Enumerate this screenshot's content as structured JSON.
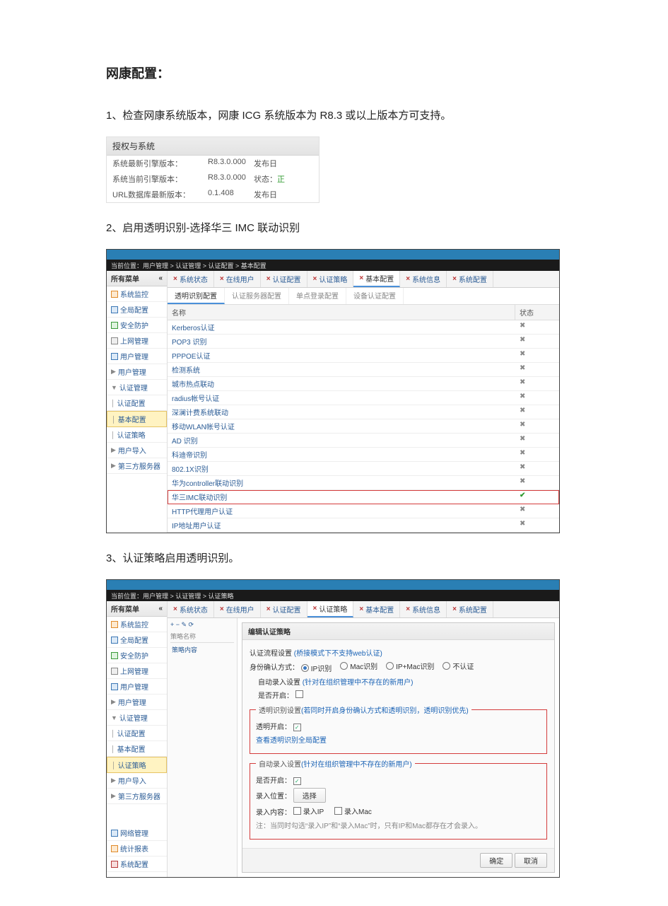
{
  "doc": {
    "title": "网康配置：",
    "step1": "1、检查网康系统版本，网康 ICG 系统版本为 R8.3 或以上版本方可支持。",
    "step2": "2、启用透明识别-选择华三 IMC 联动识别",
    "step3": "3、认证策略启用透明识别。"
  },
  "shot1": {
    "panel_title": "授权与系统",
    "rows": [
      {
        "k": "系统最新引擎版本：",
        "v": "R8.3.0.000",
        "r": "发布日"
      },
      {
        "k": "系统当前引擎版本：",
        "v": "R8.3.0.000",
        "r": "状态：",
        "r_style": "green",
        "r_val": "正"
      },
      {
        "k": "URL数据库最新版本：",
        "v": "0.1.408",
        "r": "发布日"
      }
    ]
  },
  "sidebar_title": "所有菜单",
  "sidebar": [
    {
      "label": "系统监控",
      "color": "orange"
    },
    {
      "label": "全局配置",
      "color": "blue"
    },
    {
      "label": "安全防护",
      "color": "green"
    },
    {
      "label": "上网管理",
      "color": "grey"
    },
    {
      "label": "用户管理",
      "color": "blue"
    },
    {
      "label": "用户管理",
      "color": "",
      "tree": "▶"
    },
    {
      "label": "认证管理",
      "color": "",
      "tree": "▼"
    },
    {
      "label": "认证配置",
      "color": "",
      "tree": "│ "
    },
    {
      "label": "基本配置",
      "color": "",
      "tree": "│ ",
      "sel2": true
    },
    {
      "label": "认证策略",
      "color": "",
      "tree": "│ ",
      "sel3": true
    },
    {
      "label": "用户导入",
      "color": "",
      "tree": "▶"
    },
    {
      "label": "第三方服务器",
      "color": "",
      "tree": "▶"
    }
  ],
  "sidebar_bottom": [
    {
      "label": "网络管理",
      "color": "blue"
    },
    {
      "label": "统计报表",
      "color": "orange"
    },
    {
      "label": "系统配置",
      "color": "red"
    }
  ],
  "tabs_top": [
    {
      "label": "系统状态"
    },
    {
      "label": "在线用户"
    },
    {
      "label": "认证配置"
    },
    {
      "label": "认证策略"
    },
    {
      "label": "基本配置",
      "sel": true
    },
    {
      "label": "系统信息"
    },
    {
      "label": "系统配置"
    }
  ],
  "shot2": {
    "subtabs": [
      {
        "label": "透明识别配置",
        "on": true
      },
      {
        "label": "认证服务器配置"
      },
      {
        "label": "单点登录配置"
      },
      {
        "label": "设备认证配置"
      }
    ],
    "columns": {
      "c1": "名称",
      "c2": "状态"
    },
    "rows": [
      {
        "name": "Kerberos认证",
        "enabled": false
      },
      {
        "name": "POP3 识别",
        "enabled": false
      },
      {
        "name": "PPPOE认证",
        "enabled": false
      },
      {
        "name": "检测系统",
        "enabled": false
      },
      {
        "name": "城市热点联动",
        "enabled": false
      },
      {
        "name": "radius帐号认证",
        "enabled": false
      },
      {
        "name": "深澜计费系统联动",
        "enabled": false
      },
      {
        "name": "移动WLAN帐号认证",
        "enabled": false
      },
      {
        "name": "AD 识别",
        "enabled": false
      },
      {
        "name": "科迪帝识别",
        "enabled": false
      },
      {
        "name": "802.1X识别",
        "enabled": false
      },
      {
        "name": "华为controller联动识别",
        "enabled": false
      },
      {
        "name": "华三IMC联动识别",
        "enabled": true,
        "highlight": true
      },
      {
        "name": "HTTP代理用户认证",
        "enabled": false
      },
      {
        "name": "IP地址用户认证",
        "enabled": false
      }
    ]
  },
  "shot3": {
    "left_search_label": "策略名称",
    "left_col": "策略内容",
    "dialog_title": "编辑认证策略",
    "mode_line_label": "认证流程设置",
    "mode_line_note": "(桥接模式下不支持web认证)",
    "id_method_label": "身份确认方式：",
    "radios": [
      {
        "label": "IP识别",
        "on": true
      },
      {
        "label": "Mac识别",
        "on": false
      },
      {
        "label": "IP+Mac识别",
        "on": false
      },
      {
        "label": "不认证",
        "on": false
      }
    ],
    "auto_import_label": "自动录入设置",
    "auto_import_note": "(针对在组织管理中不存在的新用户)",
    "enable_label": "是否开启：",
    "transparent_group_legend": "透明识别设置",
    "transparent_group_note": "(若同时开启身份确认方式和透明识别，透明识别优先)",
    "trans_enable_label": "透明开启：",
    "view_trans_link": "查看透明识别全局配置",
    "import_group_legend": "自动录入设置",
    "import_group_note": "(针对在组织管理中不存在的新用户)",
    "import_pos_label": "录入位置：",
    "import_pos_btn": "选择",
    "import_content_label": "录入内容：",
    "chk_ip": "录入IP",
    "chk_mac": "录入Mac",
    "note_line": "注：当同时勾选“录入IP”和“录入Mac”时，只有IP和Mac都存在才会录入。",
    "btn_ok": "确定",
    "btn_cancel": "取消"
  }
}
